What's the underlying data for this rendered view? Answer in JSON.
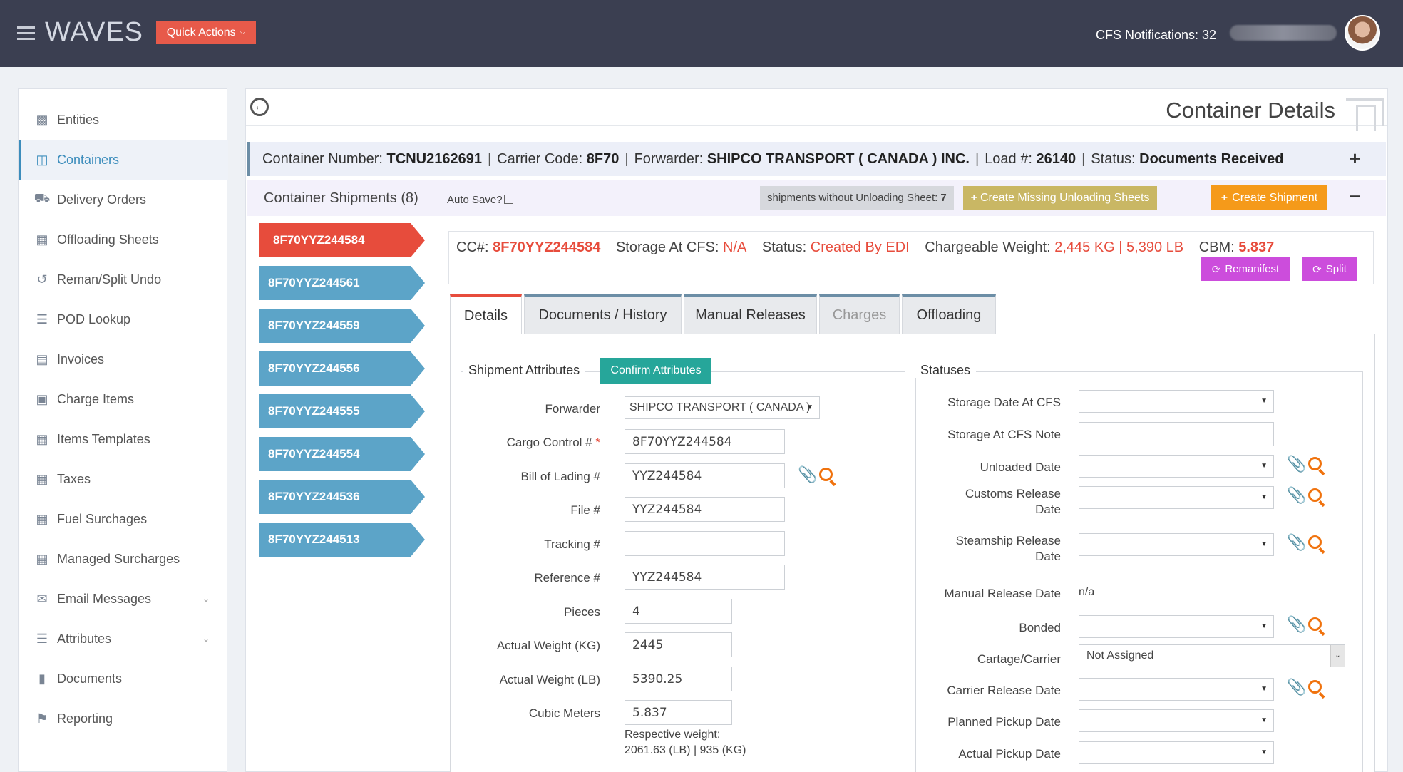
{
  "topbar": {
    "brand": "WAVES",
    "quick_actions": "Quick Actions",
    "notifications": "CFS Notifications: 32"
  },
  "sidebar": {
    "items": [
      {
        "label": "Entities",
        "icon": "briefcase-icon"
      },
      {
        "label": "Containers",
        "icon": "container-icon"
      },
      {
        "label": "Delivery Orders",
        "icon": "truck-icon"
      },
      {
        "label": "Offloading Sheets",
        "icon": "table-icon"
      },
      {
        "label": "Reman/Split Undo",
        "icon": "undo-icon"
      },
      {
        "label": "POD Lookup",
        "icon": "list-icon"
      },
      {
        "label": "Invoices",
        "icon": "credit-card-icon"
      },
      {
        "label": "Charge Items",
        "icon": "shopping-bag-icon"
      },
      {
        "label": "Items Templates",
        "icon": "grid-icon"
      },
      {
        "label": "Taxes",
        "icon": "calculator-icon"
      },
      {
        "label": "Fuel Surchages",
        "icon": "calculator-icon"
      },
      {
        "label": "Managed Surcharges",
        "icon": "calculator-icon"
      },
      {
        "label": "Email Messages",
        "icon": "envelope-icon"
      },
      {
        "label": "Attributes",
        "icon": "bullet-list-icon"
      },
      {
        "label": "Documents",
        "icon": "folder-icon"
      },
      {
        "label": "Reporting",
        "icon": "flag-icon"
      }
    ],
    "active_index": 1
  },
  "page": {
    "title": "Container Details"
  },
  "container_info": {
    "number_label": "Container Number:",
    "number": "TCNU2162691",
    "carrier_label": "Carrier Code:",
    "carrier": "8F70",
    "forwarder_label": "Forwarder:",
    "forwarder": "SHIPCO TRANSPORT ( CANADA ) INC.",
    "load_label": "Load #:",
    "load": "26140",
    "status_label": "Status:",
    "status": "Documents Received"
  },
  "shipments_bar": {
    "title": "Container Shipments (8)",
    "auto_save": "Auto Save?",
    "without_sheet_label": "shipments without Unloading Sheet:",
    "without_sheet_count": "7",
    "create_missing": "Create Missing Unloading Sheets",
    "create_shipment": "Create Shipment"
  },
  "shipments": [
    "8F70YYZ244584",
    "8F70YYZ244561",
    "8F70YYZ244559",
    "8F70YYZ244556",
    "8F70YYZ244555",
    "8F70YYZ244554",
    "8F70YYZ244536",
    "8F70YYZ244513"
  ],
  "detail": {
    "cc_label": "CC#:",
    "cc": "8F70YYZ244584",
    "storage_label": "Storage At CFS:",
    "storage": "N/A",
    "status_label": "Status:",
    "status": "Created By EDI",
    "weight_label": "Chargeable Weight:",
    "weight": "2,445 KG | 5,390 LB",
    "cbm_label": "CBM:",
    "cbm": "5.837",
    "remanifest": "Remanifest",
    "split": "Split"
  },
  "tabs": [
    "Details",
    "Documents / History",
    "Manual Releases",
    "Charges",
    "Offloading"
  ],
  "attributes": {
    "legend": "Shipment Attributes",
    "confirm": "Confirm Attributes",
    "forwarder_label": "Forwarder",
    "forwarder": "SHIPCO TRANSPORT ( CANADA )",
    "cargo_label": "Cargo Control #",
    "cargo": "8F70YYZ244584",
    "bol_label": "Bill of Lading #",
    "bol": "YYZ244584",
    "file_label": "File #",
    "file": "YYZ244584",
    "tracking_label": "Tracking #",
    "tracking": "",
    "reference_label": "Reference #",
    "reference": "YYZ244584",
    "pieces_label": "Pieces",
    "pieces": "4",
    "weight_kg_label": "Actual Weight (KG)",
    "weight_kg": "2445",
    "weight_lb_label": "Actual Weight (LB)",
    "weight_lb": "5390.25",
    "cubic_label": "Cubic Meters",
    "cubic": "5.837",
    "respective_1": "Respective weight:",
    "respective_2": "2061.63 (LB) | 935 (KG)"
  },
  "statuses": {
    "legend": "Statuses",
    "storage_date": "Storage Date At CFS",
    "storage_note": "Storage At CFS Note",
    "unloaded_date": "Unloaded Date",
    "customs_1": "Customs Release",
    "customs_2": "Date",
    "steamship_1": "Steamship Release",
    "steamship_2": "Date",
    "manual_release": "Manual Release Date",
    "manual_release_value": "n/a",
    "bonded": "Bonded",
    "cartage": "Cartage/Carrier",
    "cartage_value": "Not Assigned",
    "carrier_release": "Carrier Release Date",
    "planned_pickup": "Planned Pickup Date",
    "actual_pickup": "Actual Pickup Date"
  }
}
